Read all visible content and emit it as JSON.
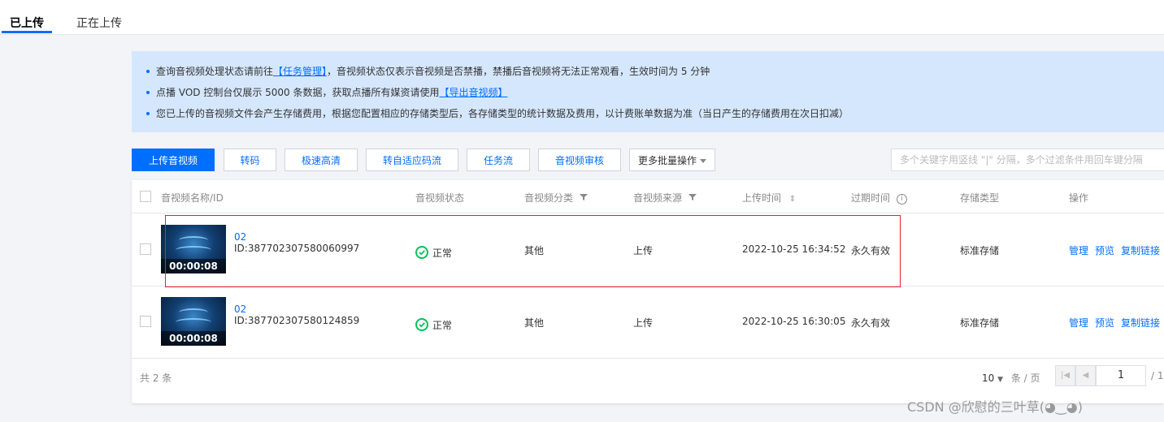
{
  "tabs": [
    {
      "label": "已上传",
      "active": true
    },
    {
      "label": "正在上传",
      "active": false
    }
  ],
  "notice": {
    "line1_prefix": "查询音视频处理状态请前往",
    "line1_link": "【任务管理】",
    "line1_suffix": "，音视频状态仅表示音视频是否禁播，禁播后音视频将无法正常观看，生效时间为 5 分钟",
    "line2_prefix": "点播 VOD 控制台仅展示 5000 条数据，获取点播所有媒资请使用",
    "line2_link": "【导出音视频】",
    "line3": "您已上传的音视频文件会产生存储费用，根据您配置相应的存储类型后，各存储类型的统计数据及费用，以计费账单数据为准（当日产生的存储费用在次日扣减）"
  },
  "toolbar": {
    "upload": "上传音视频",
    "transcode": "转码",
    "fast_hd": "极速高清",
    "adaptive": "转自适应码流",
    "workflow": "任务流",
    "review": "音视频审核",
    "more_batch": "更多批量操作",
    "search_placeholder": "多个关键字用竖线 \"|\" 分隔，多个过滤条件用回车键分隔"
  },
  "table": {
    "headers": {
      "name": "音视频名称/ID",
      "status": "音视频状态",
      "category": "音视频分类",
      "source": "音视频来源",
      "upload_time": "上传时间",
      "expire": "过期时间",
      "storage": "存储类型",
      "ops": "操作"
    },
    "rows": [
      {
        "duration": "00:00:08",
        "name": "02",
        "id": "ID:387702307580060997",
        "status": "正常",
        "category": "其他",
        "source": "上传",
        "upload_time": "2022-10-25 16:34:52",
        "expire": "永久有效",
        "storage": "标准存储",
        "op_manage": "管理",
        "op_preview": "预览",
        "op_copy": "复制链接"
      },
      {
        "duration": "00:00:08",
        "name": "02",
        "id": "ID:387702307580124859",
        "status": "正常",
        "category": "其他",
        "source": "上传",
        "upload_time": "2022-10-25 16:30:05",
        "expire": "永久有效",
        "storage": "标准存储",
        "op_manage": "管理",
        "op_preview": "预览",
        "op_copy": "复制链接"
      }
    ]
  },
  "footer": {
    "total": "共 2 条",
    "page_size": "10",
    "page_size_unit": "条 / 页",
    "current_page": "1",
    "page_total": "/ 1"
  },
  "watermark": "CSDN @欣慰的三叶草(◕‿◕)",
  "colors": {
    "primary": "#006eff",
    "success": "#0abf5b",
    "notice_bg": "#d5e7fd",
    "highlight": "#e0242d"
  }
}
